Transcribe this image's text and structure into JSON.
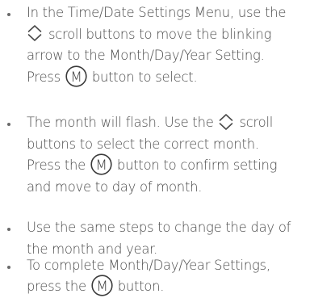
{
  "instructions": [
    {
      "lines": [
        [
          {
            "t": "In the Time/Date Settings Menu, use the"
          }
        ],
        [
          {
            "icon": "scroll-up-down-icon"
          },
          {
            "t": " scroll buttons to move the blinking"
          }
        ],
        [
          {
            "t": "arrow to the Month/Day/Year Setting."
          }
        ],
        [
          {
            "t": "Press "
          },
          {
            "icon": "m-button-icon"
          },
          {
            "t": " button to select."
          }
        ]
      ]
    },
    {
      "lines": [
        [
          {
            "t": "The month will flash. Use the "
          },
          {
            "icon": "scroll-up-down-icon"
          },
          {
            "t": " scroll"
          }
        ],
        [
          {
            "t": "buttons to select the correct month."
          }
        ],
        [
          {
            "t": "Press the "
          },
          {
            "icon": "m-button-icon"
          },
          {
            "t": " button to confirm setting"
          }
        ],
        [
          {
            "t": "and move to day of month."
          }
        ]
      ]
    },
    {
      "lines": [
        [
          {
            "t": "Use the same steps to change the day of"
          }
        ],
        [
          {
            "t": "the month and year."
          }
        ]
      ]
    },
    {
      "lines": [
        [
          {
            "t": "To complete Month/Day/Year Settings,"
          }
        ],
        [
          {
            "t": "press the "
          },
          {
            "icon": "m-button-icon"
          },
          {
            "t": " button."
          }
        ]
      ]
    }
  ],
  "icons": {
    "m-button-icon": {
      "letter": "M"
    }
  },
  "colors": {
    "text": "#4a4a4a",
    "bullet": "#6a6a6a"
  }
}
